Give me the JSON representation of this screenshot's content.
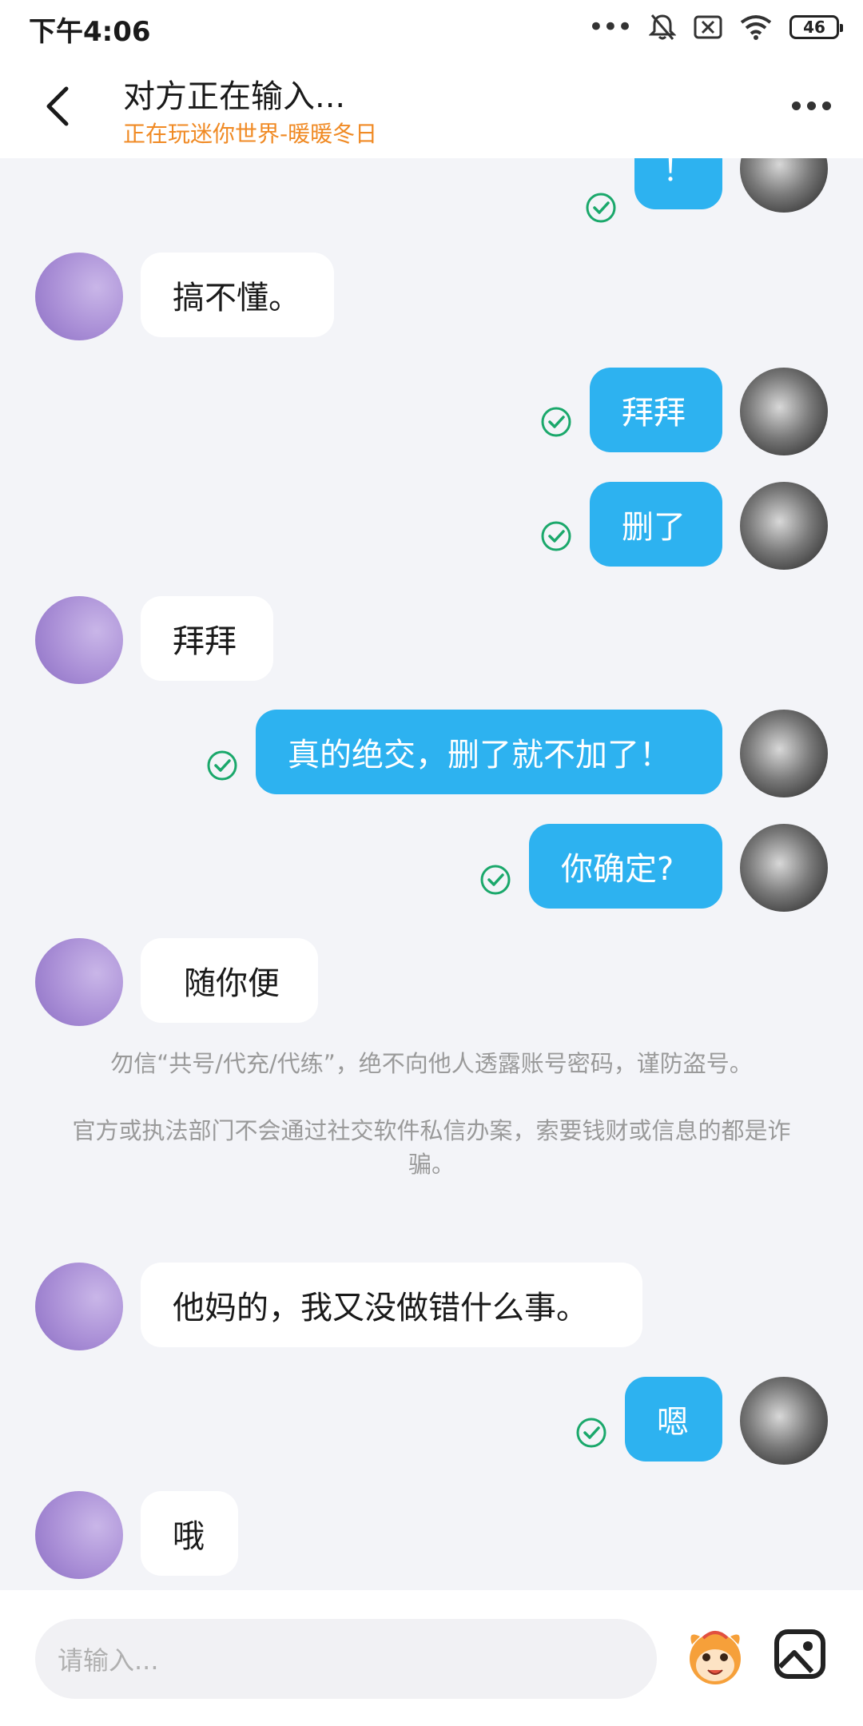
{
  "status_bar": {
    "time": "下午4:06",
    "battery": "46"
  },
  "header": {
    "title": "对方正在输入...",
    "subtitle": "正在玩迷你世界-暖暖冬日",
    "back_icon": "chevron-left-icon",
    "more_icon": "more-dots-icon"
  },
  "messages": [
    {
      "from": "self",
      "text": "！",
      "read": true
    },
    {
      "from": "other",
      "text": "搞不懂。"
    },
    {
      "from": "self",
      "text": "拜拜",
      "read": true
    },
    {
      "from": "self",
      "text": "删了",
      "read": true
    },
    {
      "from": "other",
      "text": "拜拜"
    },
    {
      "from": "self",
      "text": "真的绝交，删了就不加了！",
      "read": true
    },
    {
      "from": "self",
      "text": "你确定?",
      "read": true
    },
    {
      "from": "other",
      "text": "随你便"
    },
    {
      "from": "other",
      "text": "他妈的，我又没做错什么事。"
    },
    {
      "from": "self",
      "text": "嗯",
      "read": true
    },
    {
      "from": "other",
      "text": "哦"
    }
  ],
  "notice": {
    "line1": "勿信“共号/代充/代练”，绝不向他人透露账号密码，谨防盗号。",
    "line2": "官方或执法部门不会通过社交软件私信办案，索要钱财或信息的都是诈骗。"
  },
  "input": {
    "placeholder": "请输入..."
  },
  "colors": {
    "accent": "#2db2f0",
    "subtitle": "#f08a24",
    "read_check": "#1aa86b",
    "background": "#f3f4f8"
  }
}
